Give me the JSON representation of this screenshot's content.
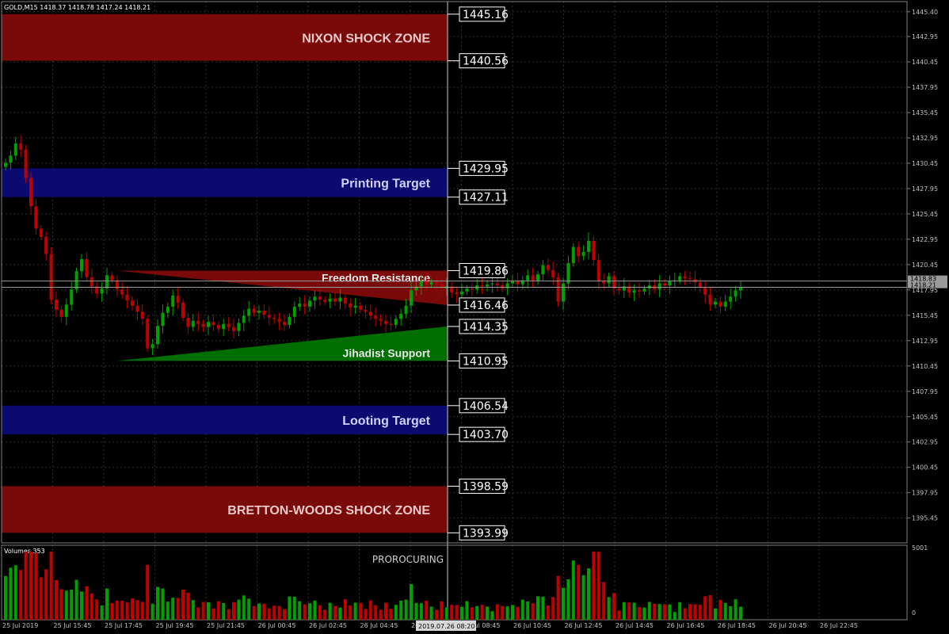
{
  "header": {
    "symbol_info": "GOLD,M15  1418.37 1418.78 1417.24 1418.21"
  },
  "colors": {
    "background": "#000000",
    "grid": "#303030",
    "bull": "#00a000",
    "bear": "#c00000",
    "zone_red": "#7a0a0a",
    "zone_blue": "#0a0a70",
    "zone_green": "#006e00",
    "axis_text": "#c0c0c0",
    "crosshair": "#c8c8c8"
  },
  "zones": [
    {
      "name": "nixon-shock-zone",
      "label": "NIXON SHOCK ZONE",
      "top": 1445.16,
      "bottom": 1440.56,
      "color": "#7a0a0a",
      "label_color": "#e6c8c8"
    },
    {
      "name": "printing-target",
      "label": "Printing Target",
      "top": 1429.95,
      "bottom": 1427.11,
      "color": "#0a0a70",
      "label_color": "#d0d0ff"
    },
    {
      "name": "looting-target",
      "label": "Looting Target",
      "top": 1406.54,
      "bottom": 1403.7,
      "color": "#0a0a70",
      "label_color": "#d0d0ff"
    },
    {
      "name": "bretton-woods-shock-zone",
      "label": "BRETTON-WOODS SHOCK ZONE",
      "top": 1398.59,
      "bottom": 1393.99,
      "color": "#7a0a0a",
      "label_color": "#e6c8c8"
    }
  ],
  "triangles": [
    {
      "name": "freedom-resistance",
      "label": "Freedom Resistance",
      "start_bar": 22,
      "apex": 1419.86,
      "end_top": 1419.86,
      "end_bottom": 1416.46,
      "color": "#7a0a0a"
    },
    {
      "name": "jihadist-support",
      "label": "Jihadist Support",
      "start_bar": 22,
      "apex": 1410.95,
      "end_top": 1414.35,
      "end_bottom": 1410.95,
      "color": "#006e00"
    }
  ],
  "price_tags": [
    "1445.16",
    "1440.56",
    "1429.95",
    "1427.11",
    "1419.86",
    "1416.46",
    "1414.35",
    "1410.95",
    "1406.54",
    "1403.70",
    "1398.59",
    "1393.99"
  ],
  "current_price_labels": [
    "1418.83",
    "1418.21"
  ],
  "crosshair_date": "2019.07.26 08:20",
  "volume_panel": {
    "title": "Volumes 353",
    "indicator_label": "PROROCURING",
    "scale_max": "5001",
    "scale_min": "0"
  },
  "chart_data": {
    "type": "candlestick",
    "symbol": "GOLD",
    "timeframe": "M15",
    "ylim": [
      1393.0,
      1446.4
    ],
    "y_ticks": [
      "1445.40",
      "1442.95",
      "1440.45",
      "1437.95",
      "1435.45",
      "1432.95",
      "1430.45",
      "1427.95",
      "1425.45",
      "1422.95",
      "1420.45",
      "1417.95",
      "1415.45",
      "1412.95",
      "1410.45",
      "1407.95",
      "1405.45",
      "1402.95",
      "1400.45",
      "1397.95",
      "1395.45"
    ],
    "x_ticks": [
      "25 Jul 2019",
      "25 Jul 15:45",
      "25 Jul 17:45",
      "25 Jul 19:45",
      "25 Jul 21:45",
      "26 Jul 00:45",
      "26 Jul 02:45",
      "26 Jul 04:45",
      "26 Jul 06:45",
      "26 Jul 08:45",
      "26 Jul 10:45",
      "26 Jul 12:45",
      "26 Jul 14:45",
      "26 Jul 16:45",
      "26 Jul 18:45",
      "26 Jul 20:45",
      "26 Jul 22:45"
    ],
    "close": [
      1430.5,
      1431.2,
      1432.4,
      1431.8,
      1429.0,
      1426.2,
      1424.0,
      1423.2,
      1421.5,
      1417.0,
      1416.0,
      1415.3,
      1416.5,
      1418.0,
      1419.8,
      1421.0,
      1419.2,
      1418.3,
      1417.6,
      1418.1,
      1419.4,
      1418.9,
      1418.0,
      1417.5,
      1416.9,
      1416.4,
      1415.8,
      1415.1,
      1412.2,
      1412.6,
      1414.4,
      1415.7,
      1416.3,
      1417.4,
      1416.7,
      1415.2,
      1414.3,
      1414.9,
      1414.6,
      1414.3,
      1414.8,
      1414.5,
      1414.1,
      1414.6,
      1414.3,
      1413.9,
      1414.7,
      1415.4,
      1416.1,
      1415.7,
      1415.9,
      1415.5,
      1415.2,
      1415.1,
      1414.8,
      1414.5,
      1415.3,
      1416.3,
      1416.6,
      1416.3,
      1416.9,
      1417.3,
      1417.0,
      1416.8,
      1417.1,
      1416.8,
      1417.2,
      1416.6,
      1416.2,
      1416.4,
      1416.0,
      1415.8,
      1415.4,
      1415.1,
      1414.9,
      1414.6,
      1414.5,
      1415.1,
      1415.6,
      1416.4,
      1417.9,
      1418.3,
      1418.9,
      1418.5,
      1418.7,
      1418.5,
      1418.1,
      1418.3,
      1417.7,
      1417.5,
      1417.8,
      1418.1,
      1418.0,
      1418.4,
      1418.3,
      1418.5,
      1418.6,
      1418.4,
      1418.1,
      1418.6,
      1418.8,
      1418.5,
      1418.9,
      1419.4,
      1418.8,
      1419.5,
      1420.4,
      1419.9,
      1419.2,
      1416.8,
      1418.6,
      1420.6,
      1422.2,
      1421.3,
      1421.7,
      1422.8,
      1420.9,
      1418.8,
      1418.6,
      1419.3,
      1418.1,
      1417.9,
      1418.3,
      1417.7,
      1417.9,
      1417.8,
      1418.1,
      1418.4,
      1418.0,
      1418.6,
      1418.4,
      1418.8,
      1418.9,
      1419.3,
      1419.1,
      1419.0,
      1418.7,
      1418.2,
      1417.5,
      1416.5,
      1416.8,
      1416.3,
      1416.8,
      1417.3,
      1417.9,
      1418.2
    ]
  }
}
